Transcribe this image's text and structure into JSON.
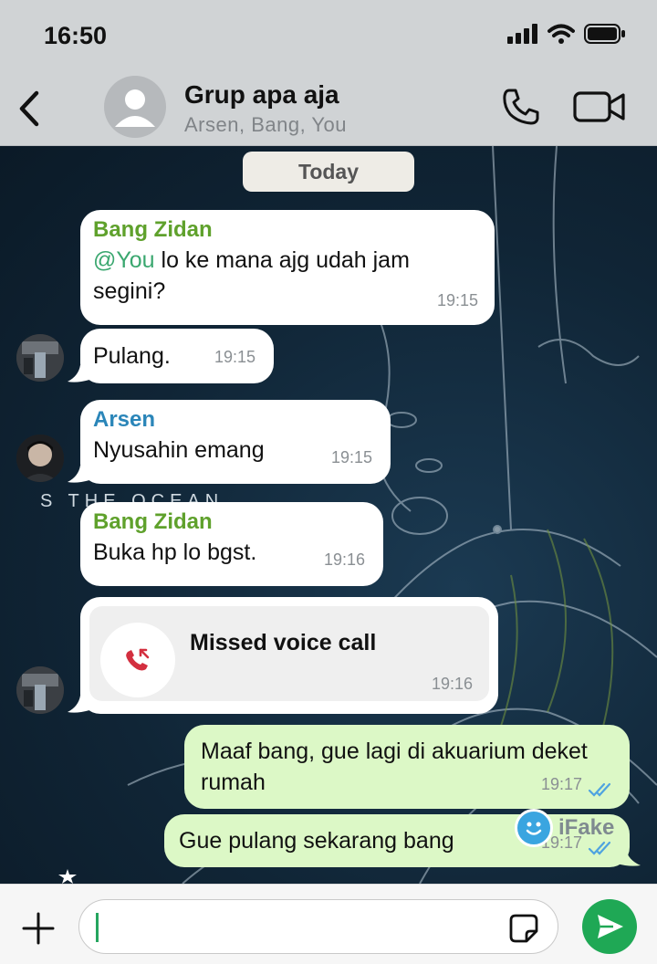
{
  "status_bar": {
    "time": "16:50"
  },
  "header": {
    "title": "Grup apa aja",
    "subtitle": "Arsen, Bang, You"
  },
  "chat": {
    "date_label": "Today",
    "wallpaper_text": "S   THE  OCEAN",
    "messages": [
      {
        "sender": "Bang Zidan",
        "mention": "@You",
        "text": " lo ke mana ajg udah jam segini?",
        "time": "19:15"
      },
      {
        "text": "Pulang.",
        "time": "19:15"
      },
      {
        "sender": "Arsen",
        "text": "Nyusahin emang",
        "time": "19:15"
      },
      {
        "sender": "Bang Zidan",
        "text": "Buka hp lo bgst.",
        "time": "19:16"
      },
      {
        "call": "Missed voice call",
        "time": "19:16"
      },
      {
        "outgoing": true,
        "text": "Maaf bang, gue lagi di akuarium deket rumah",
        "time": "19:17"
      },
      {
        "outgoing": true,
        "text": "Gue pulang sekarang bang",
        "time": "19:17"
      }
    ],
    "watermark": "iFake"
  },
  "colors": {
    "sender_green": "#5fa12c",
    "sender_blue": "#2b86b9",
    "out_bubble": "#dcf8c6",
    "send_button": "#1fa855",
    "missed_call_red": "#d32f3f",
    "read_tick": "#4fa3e0"
  }
}
